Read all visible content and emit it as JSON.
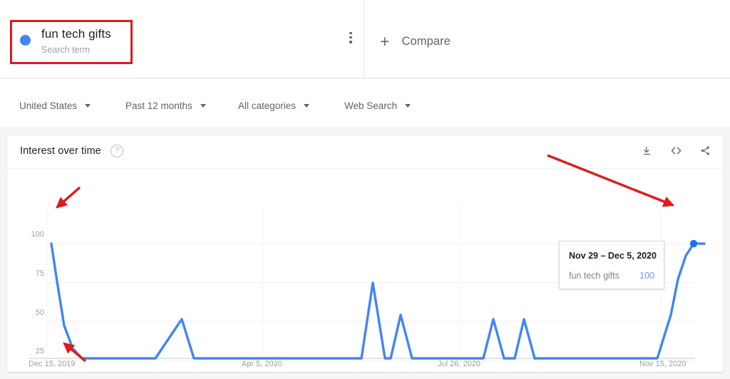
{
  "term": {
    "name": "fun tech gifts",
    "type_label": "Search term",
    "dot_color": "#4285f4",
    "menu_icon": "more-vertical-icon"
  },
  "compare": {
    "label": "Compare",
    "plus_icon": "plus-icon"
  },
  "filters": [
    {
      "label": "United States",
      "caret_icon": "chevron-down-icon",
      "x": 27
    },
    {
      "label": "Past 12 months",
      "caret_icon": "chevron-down-icon",
      "x": 176
    },
    {
      "label": "All categories",
      "caret_icon": "chevron-down-icon",
      "x": 334
    },
    {
      "label": "Web Search",
      "caret_icon": "chevron-down-icon",
      "x": 483
    }
  ],
  "chart_card": {
    "title": "Interest over time",
    "help_icon": "question-mark-icon",
    "actions": [
      {
        "name": "download-icon"
      },
      {
        "name": "embed-code-icon"
      },
      {
        "name": "share-icon"
      }
    ]
  },
  "tooltip": {
    "date_range": "Nov 29 – Dec 5, 2020",
    "series_name": "fun tech gifts",
    "value": "100"
  },
  "annotations": {
    "highlight_box_color": "#e01b1b",
    "arrow_color": "#e01b1b",
    "arrow_count": "3"
  },
  "chart_data": {
    "type": "line",
    "title": "Interest over time",
    "xlabel": "",
    "ylabel": "",
    "ylim": [
      0,
      100
    ],
    "yticks": [
      "100",
      "75",
      "50",
      "25"
    ],
    "ytick_values": [
      100,
      75,
      50,
      25
    ],
    "xticks": [
      "Dec 15, 2019",
      "Apr 5, 2020",
      "Jul 26, 2020",
      "Nov 15, 2020"
    ],
    "grid": true,
    "legend_position": "none",
    "line_color": "#4285f4",
    "marker_color": "#1a73e8",
    "series": [
      {
        "name": "fun tech gifts",
        "values": [
          100,
          33,
          8,
          0,
          0,
          0,
          0,
          0,
          0,
          0,
          0,
          0,
          0,
          0,
          0,
          0,
          27,
          0,
          0,
          0,
          0,
          0,
          0,
          0,
          0,
          0,
          0,
          0,
          0,
          0,
          0,
          0,
          0,
          0,
          0,
          0,
          0,
          0,
          0,
          50,
          0,
          28,
          0,
          0,
          0,
          0,
          0,
          0,
          0,
          0,
          0,
          27,
          0,
          27,
          0,
          0,
          0,
          0,
          0,
          0,
          0,
          0,
          0,
          0,
          0,
          0,
          0,
          0,
          0,
          0,
          0,
          0,
          0,
          0,
          0,
          0,
          0,
          0,
          0,
          0,
          0,
          0,
          0,
          0,
          0,
          0,
          0,
          0,
          0,
          0,
          0,
          0,
          0,
          0,
          0,
          0,
          0,
          0,
          0,
          0,
          18,
          63,
          88,
          100,
          100
        ]
      }
    ],
    "peak_value": 100,
    "peak_label": "Nov 29 – Dec 5, 2020"
  }
}
